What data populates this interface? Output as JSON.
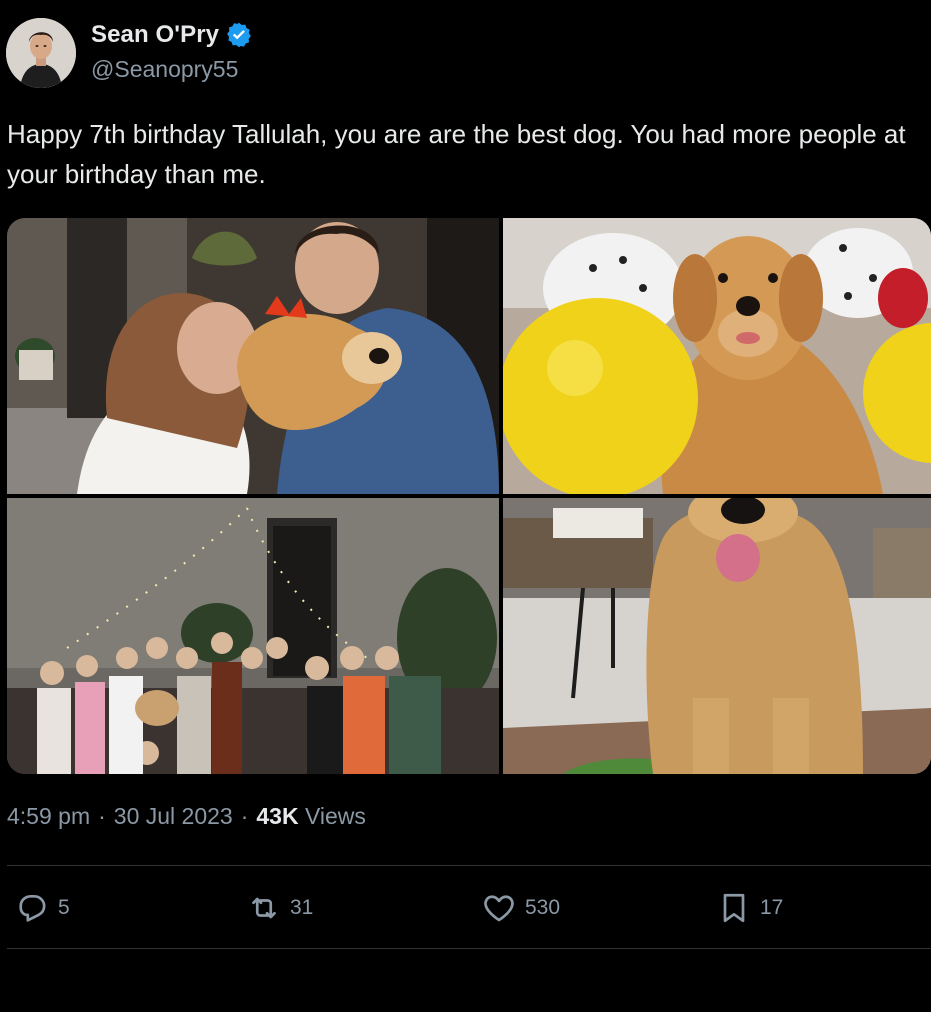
{
  "author": {
    "display_name": "Sean O'Pry",
    "handle": "@Seanopry55",
    "verified": true
  },
  "tweet": {
    "text": "Happy 7th birthday Tallulah, you are are the best dog. You had more people at your birthday than me."
  },
  "media": [
    {
      "label": "couple-hugging-dog-with-red-bow"
    },
    {
      "label": "golden-retriever-with-balloons"
    },
    {
      "label": "party-group-photo"
    },
    {
      "label": "golden-retriever-on-patio"
    }
  ],
  "meta": {
    "time": "4:59 pm",
    "separator": "·",
    "date": "30 Jul 2023",
    "views_count": "43K",
    "views_label": "Views"
  },
  "actions": {
    "replies": "5",
    "retweets": "31",
    "likes": "530",
    "bookmarks": "17"
  },
  "colors": {
    "background": "#000000",
    "text_primary": "#e7e9ea",
    "text_secondary": "#8b98a5",
    "verified_blue": "#1d9bf0",
    "divider": "#2f3336"
  }
}
